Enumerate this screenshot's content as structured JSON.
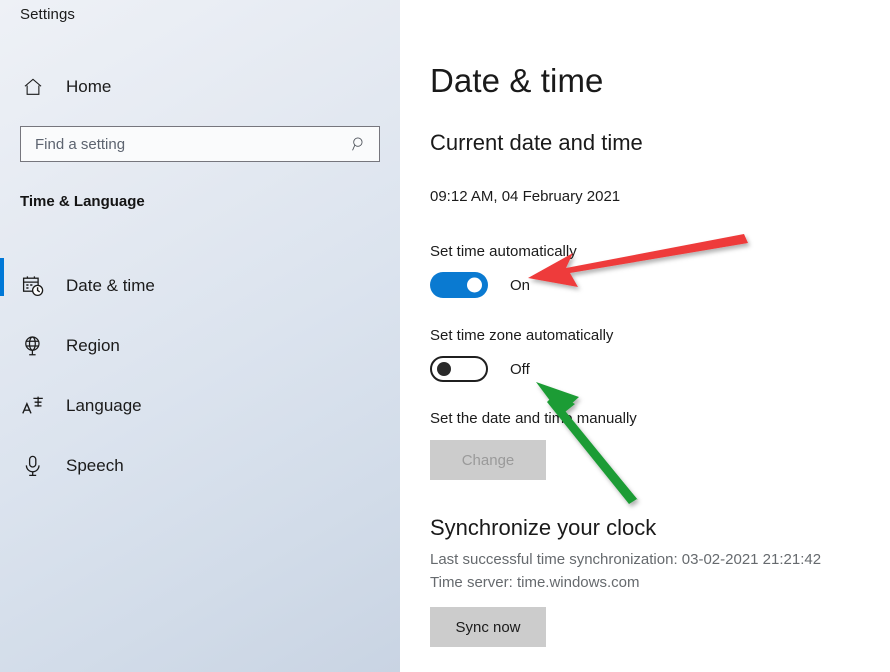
{
  "sidebar": {
    "app_title": "Settings",
    "home": {
      "label": "Home",
      "icon": "home-icon"
    },
    "search": {
      "placeholder": "Find a setting",
      "value": "",
      "icon": "search-icon"
    },
    "group_title": "Time & Language",
    "items": [
      {
        "label": "Date & time",
        "icon": "calendar-clock-icon",
        "selected": true
      },
      {
        "label": "Region",
        "icon": "globe-icon",
        "selected": false
      },
      {
        "label": "Language",
        "icon": "language-icon",
        "selected": false
      },
      {
        "label": "Speech",
        "icon": "microphone-icon",
        "selected": false
      }
    ]
  },
  "main": {
    "page_title": "Date & time",
    "sections": {
      "current": {
        "heading": "Current date and time",
        "datetime": "09:12 AM, 04 February 2021",
        "set_time_auto": {
          "label": "Set time automatically",
          "state": "On",
          "on": true
        },
        "set_timezone_auto": {
          "label": "Set time zone automatically",
          "state": "Off",
          "on": false
        },
        "manual": {
          "label": "Set the date and time manually",
          "button": "Change",
          "disabled": true
        }
      },
      "sync": {
        "heading": "Synchronize your clock",
        "last_sync": "Last successful time synchronization: 03-02-2021 21:21:42",
        "time_server": "Time server: time.windows.com",
        "button": "Sync now"
      }
    }
  },
  "annotations": {
    "red_arrow": {
      "color": "#ee3b3b",
      "points_to": "set-time-automatically-toggle"
    },
    "green_arrow": {
      "color": "#1f9c35",
      "points_to": "set-time-zone-automatically-toggle"
    }
  },
  "colors": {
    "accent": "#0078d7",
    "toggle_on": "#0a7ad1",
    "button_face": "#cccccc",
    "disabled_text": "#9a9a9a"
  }
}
